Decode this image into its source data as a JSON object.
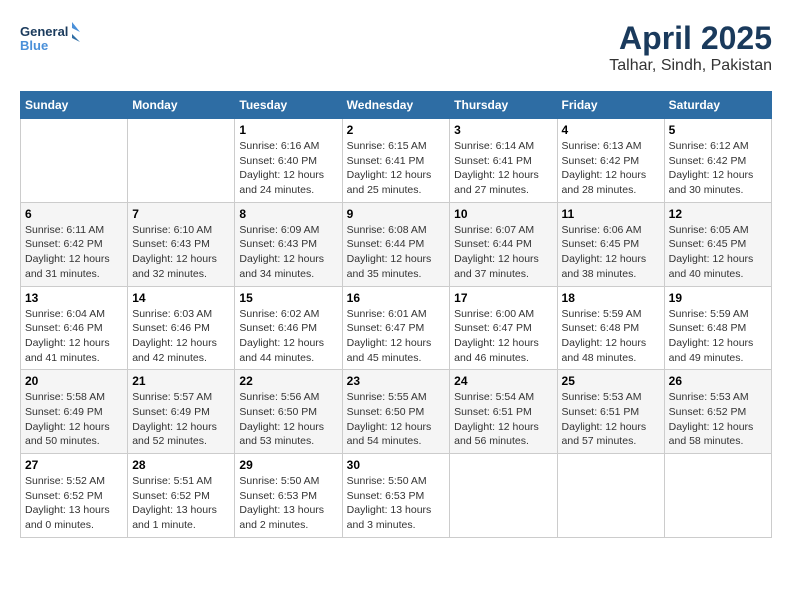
{
  "header": {
    "logo_line1": "General",
    "logo_line2": "Blue",
    "title": "April 2025",
    "subtitle": "Talhar, Sindh, Pakistan"
  },
  "calendar": {
    "weekdays": [
      "Sunday",
      "Monday",
      "Tuesday",
      "Wednesday",
      "Thursday",
      "Friday",
      "Saturday"
    ],
    "weeks": [
      [
        {
          "day": "",
          "info": ""
        },
        {
          "day": "",
          "info": ""
        },
        {
          "day": "1",
          "info": "Sunrise: 6:16 AM\nSunset: 6:40 PM\nDaylight: 12 hours\nand 24 minutes."
        },
        {
          "day": "2",
          "info": "Sunrise: 6:15 AM\nSunset: 6:41 PM\nDaylight: 12 hours\nand 25 minutes."
        },
        {
          "day": "3",
          "info": "Sunrise: 6:14 AM\nSunset: 6:41 PM\nDaylight: 12 hours\nand 27 minutes."
        },
        {
          "day": "4",
          "info": "Sunrise: 6:13 AM\nSunset: 6:42 PM\nDaylight: 12 hours\nand 28 minutes."
        },
        {
          "day": "5",
          "info": "Sunrise: 6:12 AM\nSunset: 6:42 PM\nDaylight: 12 hours\nand 30 minutes."
        }
      ],
      [
        {
          "day": "6",
          "info": "Sunrise: 6:11 AM\nSunset: 6:42 PM\nDaylight: 12 hours\nand 31 minutes."
        },
        {
          "day": "7",
          "info": "Sunrise: 6:10 AM\nSunset: 6:43 PM\nDaylight: 12 hours\nand 32 minutes."
        },
        {
          "day": "8",
          "info": "Sunrise: 6:09 AM\nSunset: 6:43 PM\nDaylight: 12 hours\nand 34 minutes."
        },
        {
          "day": "9",
          "info": "Sunrise: 6:08 AM\nSunset: 6:44 PM\nDaylight: 12 hours\nand 35 minutes."
        },
        {
          "day": "10",
          "info": "Sunrise: 6:07 AM\nSunset: 6:44 PM\nDaylight: 12 hours\nand 37 minutes."
        },
        {
          "day": "11",
          "info": "Sunrise: 6:06 AM\nSunset: 6:45 PM\nDaylight: 12 hours\nand 38 minutes."
        },
        {
          "day": "12",
          "info": "Sunrise: 6:05 AM\nSunset: 6:45 PM\nDaylight: 12 hours\nand 40 minutes."
        }
      ],
      [
        {
          "day": "13",
          "info": "Sunrise: 6:04 AM\nSunset: 6:46 PM\nDaylight: 12 hours\nand 41 minutes."
        },
        {
          "day": "14",
          "info": "Sunrise: 6:03 AM\nSunset: 6:46 PM\nDaylight: 12 hours\nand 42 minutes."
        },
        {
          "day": "15",
          "info": "Sunrise: 6:02 AM\nSunset: 6:46 PM\nDaylight: 12 hours\nand 44 minutes."
        },
        {
          "day": "16",
          "info": "Sunrise: 6:01 AM\nSunset: 6:47 PM\nDaylight: 12 hours\nand 45 minutes."
        },
        {
          "day": "17",
          "info": "Sunrise: 6:00 AM\nSunset: 6:47 PM\nDaylight: 12 hours\nand 46 minutes."
        },
        {
          "day": "18",
          "info": "Sunrise: 5:59 AM\nSunset: 6:48 PM\nDaylight: 12 hours\nand 48 minutes."
        },
        {
          "day": "19",
          "info": "Sunrise: 5:59 AM\nSunset: 6:48 PM\nDaylight: 12 hours\nand 49 minutes."
        }
      ],
      [
        {
          "day": "20",
          "info": "Sunrise: 5:58 AM\nSunset: 6:49 PM\nDaylight: 12 hours\nand 50 minutes."
        },
        {
          "day": "21",
          "info": "Sunrise: 5:57 AM\nSunset: 6:49 PM\nDaylight: 12 hours\nand 52 minutes."
        },
        {
          "day": "22",
          "info": "Sunrise: 5:56 AM\nSunset: 6:50 PM\nDaylight: 12 hours\nand 53 minutes."
        },
        {
          "day": "23",
          "info": "Sunrise: 5:55 AM\nSunset: 6:50 PM\nDaylight: 12 hours\nand 54 minutes."
        },
        {
          "day": "24",
          "info": "Sunrise: 5:54 AM\nSunset: 6:51 PM\nDaylight: 12 hours\nand 56 minutes."
        },
        {
          "day": "25",
          "info": "Sunrise: 5:53 AM\nSunset: 6:51 PM\nDaylight: 12 hours\nand 57 minutes."
        },
        {
          "day": "26",
          "info": "Sunrise: 5:53 AM\nSunset: 6:52 PM\nDaylight: 12 hours\nand 58 minutes."
        }
      ],
      [
        {
          "day": "27",
          "info": "Sunrise: 5:52 AM\nSunset: 6:52 PM\nDaylight: 13 hours\nand 0 minutes."
        },
        {
          "day": "28",
          "info": "Sunrise: 5:51 AM\nSunset: 6:52 PM\nDaylight: 13 hours\nand 1 minute."
        },
        {
          "day": "29",
          "info": "Sunrise: 5:50 AM\nSunset: 6:53 PM\nDaylight: 13 hours\nand 2 minutes."
        },
        {
          "day": "30",
          "info": "Sunrise: 5:50 AM\nSunset: 6:53 PM\nDaylight: 13 hours\nand 3 minutes."
        },
        {
          "day": "",
          "info": ""
        },
        {
          "day": "",
          "info": ""
        },
        {
          "day": "",
          "info": ""
        }
      ]
    ]
  }
}
